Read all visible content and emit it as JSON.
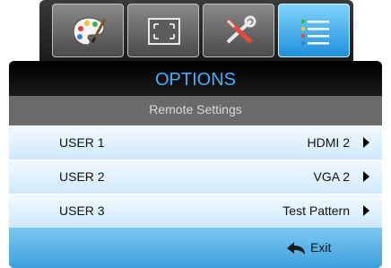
{
  "tabs": [
    {
      "icon": "palette-icon",
      "active": false
    },
    {
      "icon": "screen-resize-icon",
      "active": false
    },
    {
      "icon": "tools-icon",
      "active": false
    },
    {
      "icon": "options-list-icon",
      "active": true
    }
  ],
  "menu": {
    "title": "OPTIONS",
    "subtitle": "Remote Settings",
    "items": [
      {
        "label": "USER 1",
        "value": "HDMI 2"
      },
      {
        "label": "USER 2",
        "value": "VGA 2"
      },
      {
        "label": "USER 3",
        "value": "Test Pattern"
      }
    ],
    "exit_label": "Exit"
  },
  "colors": {
    "title_text": "#3fb1ff",
    "active_tab": "#1f90d8",
    "row_bg": "#dff1fc",
    "footer_bg": "#5ab4e8"
  }
}
